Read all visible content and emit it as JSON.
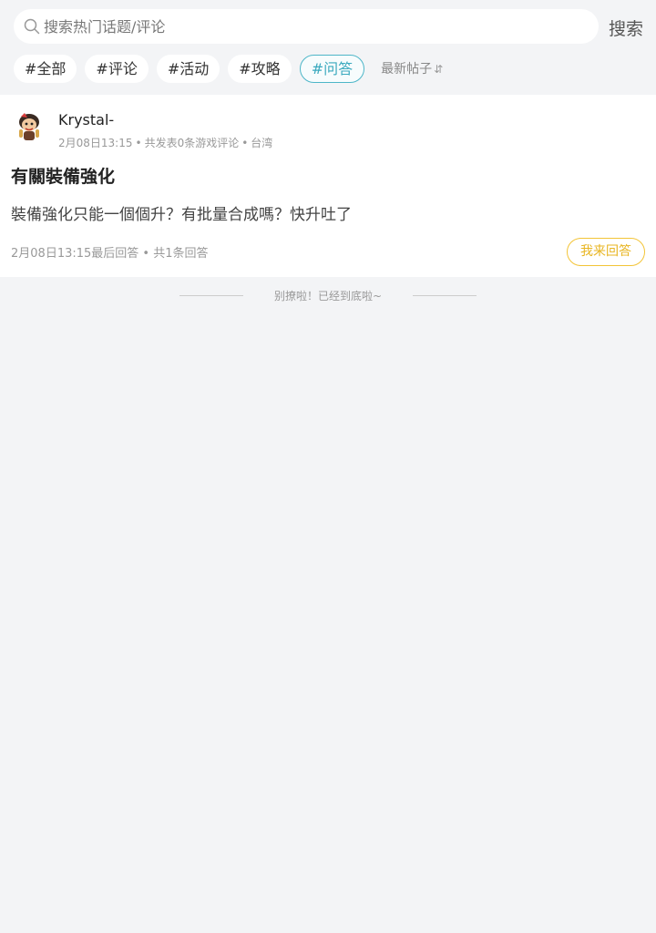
{
  "search": {
    "placeholder": "搜索热门话题/评论",
    "button_label": "搜索"
  },
  "tags": [
    {
      "label": "#全部"
    },
    {
      "label": "#评论"
    },
    {
      "label": "#活动"
    },
    {
      "label": "#攻略"
    },
    {
      "label": "#问答",
      "active": true
    }
  ],
  "sort": {
    "label": "最新帖子",
    "icon": "sort-arrows-icon"
  },
  "post": {
    "username": "Krystal-",
    "date": "2月08日13:15",
    "reviews": "共发表0条游戏评论",
    "region": "台湾",
    "title": "有關裝備強化",
    "body": "裝備強化只能一個個升？有批量合成嗎？快升吐了",
    "last_reply": "2月08日13:15最后回答",
    "reply_count": "共1条回答",
    "answer_button": "我来回答"
  },
  "end_text": "别撩啦！已经到底啦~",
  "colors": {
    "accent": "#3aa9be",
    "answer": "#e8b521",
    "background": "#f3f4f6"
  }
}
